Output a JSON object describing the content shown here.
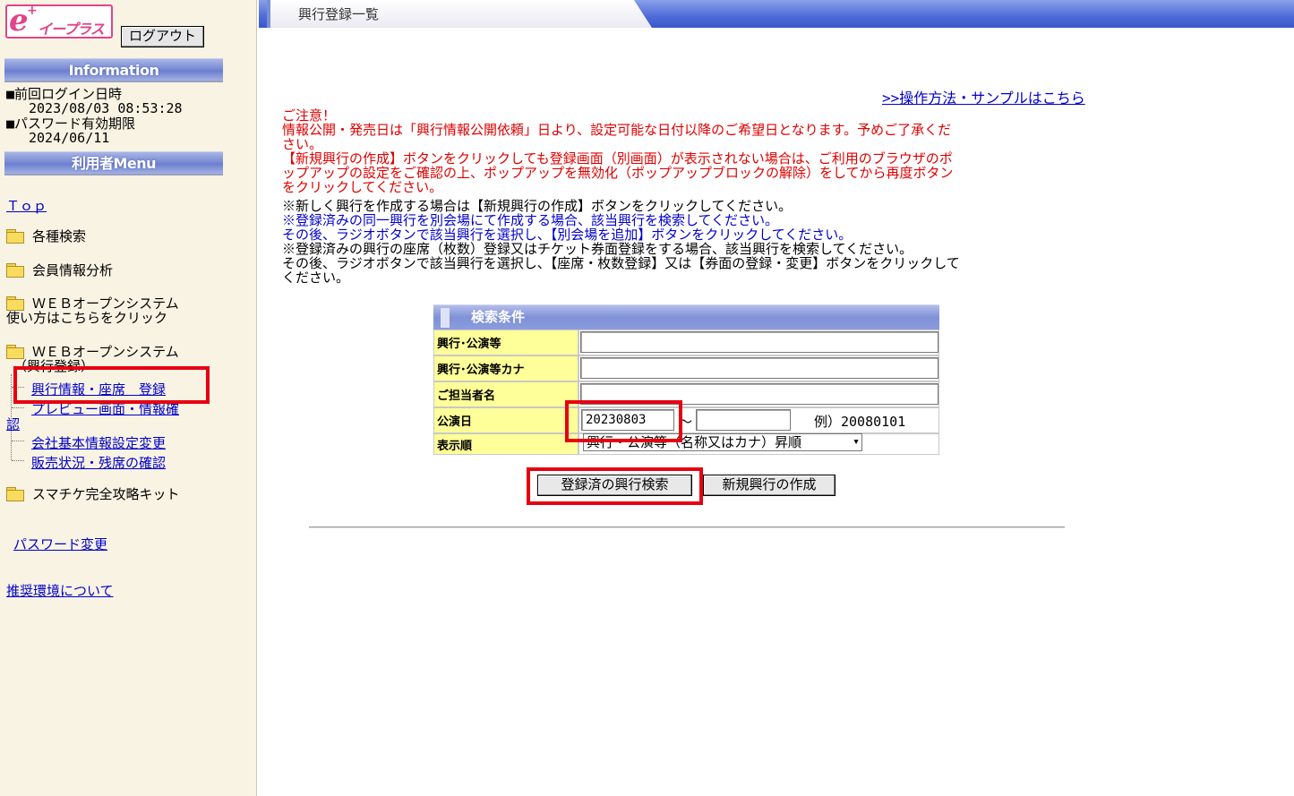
{
  "app": {
    "logo_text": "イープラス",
    "logout_label": "ログアウト"
  },
  "sidebar": {
    "info_header": "Information",
    "last_login_label": "■前回ログイン日時",
    "last_login_value": "2023/08/03 08:53:28",
    "password_expiry_label": "■パスワード有効期限",
    "password_expiry_value": "2024/06/11",
    "menu_header": "利用者Menu",
    "top_link": "Ｔｏｐ",
    "items": [
      {
        "label": "各種検索"
      },
      {
        "label": "会員情報分析"
      },
      {
        "label": "ＷＥＢオープンシステム",
        "label2": "使い方はこちらをクリック"
      },
      {
        "label": "ＷＥＢオープンシステム",
        "label2": "（興行登録）"
      }
    ],
    "subitems": [
      {
        "label": "興行情報・座席　登録"
      },
      {
        "label": "プレビュー画面・情報確",
        "label2": "認"
      },
      {
        "label": "会社基本情報設定変更"
      },
      {
        "label": "販売状況・残席の確認"
      }
    ],
    "kit_item": "スマチケ完全攻略キット",
    "password_change": "パスワード変更",
    "recommended_env": "推奨環境について"
  },
  "main": {
    "title": "興行登録一覧",
    "manual_link": ">>操作方法・サンプルはこちら",
    "notes_red": [
      "ご注意！",
      " 情報公開・発売日は「興行情報公開依頼」日より、設定可能な日付以降のご希望日となります。予めご了承くだ",
      " さい。",
      " 【新規興行の作成】ボタンをクリックしても登録画面（別画面）が表示されない場合は、ご利用のブラウザのポ",
      " ップアップの設定をご確認の上、ポップアップを無効化（ポップアップブロックの解除）をしてから再度ボタン",
      " をクリックしてください。"
    ],
    "notes": [
      {
        "text": "※新しく興行を作成する場合は【新規興行の作成】ボタンをクリックしてください。",
        "color": "black"
      },
      {
        "text": "※登録済みの同一興行を別会場にて作成する場合、該当興行を検索してください。",
        "color": "blue"
      },
      {
        "text": "その後、ラジオボタンで該当興行を選択し、【別会場を追加】ボタンをクリックしてください。",
        "color": "blue"
      },
      {
        "text": "※登録済みの興行の座席（枚数）登録又はチケット券面登録をする場合、該当興行を検索してください。",
        "color": "black"
      },
      {
        "text": "その後、ラジオボタンで該当興行を選択し、【座席・枚数登録】又は【券面の登録・変更】ボタンをクリックして",
        "color": "black"
      },
      {
        "text": "ください。",
        "color": "black"
      }
    ]
  },
  "search": {
    "title": "検索条件",
    "label_event": "興行･公演等",
    "label_event_kana": "興行･公演等カナ",
    "label_manager": "ご担当者名",
    "label_date": "公演日",
    "label_order": "表示順",
    "date_from": "20230803",
    "date_to": "",
    "date_sep": "～",
    "date_example": "例）20080101",
    "order_value": "興行・公演等（名称又はカナ）昇順",
    "btn_search": "登録済の興行検索",
    "btn_create": "新規興行の作成"
  },
  "colors": {
    "highlight": "#e60012",
    "label_bg": "#ffff99",
    "header_blue": "#7a8cd4",
    "sidebar_bg": "#f8f3e3",
    "warning_red": "#e00000",
    "link_blue": "#0000cc"
  }
}
